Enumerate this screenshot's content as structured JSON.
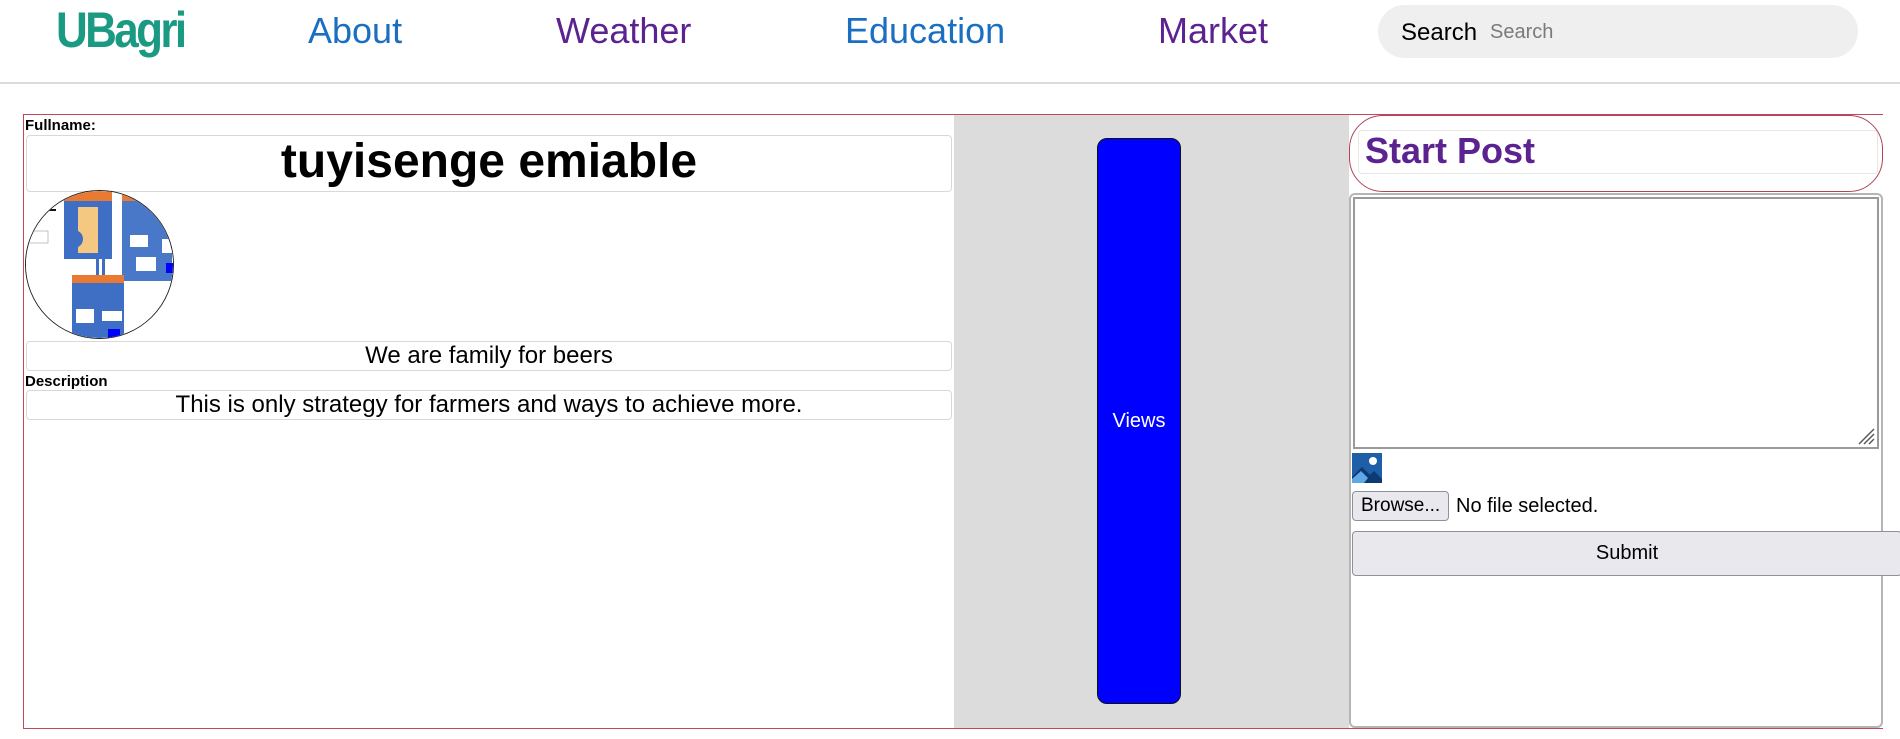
{
  "header": {
    "logo_text": "UBagri",
    "nav": [
      {
        "label": "About"
      },
      {
        "label": "Weather"
      },
      {
        "label": "Education"
      },
      {
        "label": "Market"
      }
    ],
    "search": {
      "label": "Search",
      "placeholder": "Search",
      "value": ""
    }
  },
  "profile": {
    "fullname_label": "Fullname:",
    "fullname": "tuyisenge emiable",
    "motto": "We are family for beers",
    "description_label": "Description",
    "description": "This is only strategy for farmers and ways to achieve more."
  },
  "stats": {
    "views_label": "Views"
  },
  "post": {
    "heading": "Start Post",
    "textarea_value": "",
    "browse_label": "Browse...",
    "file_status": "No file selected.",
    "submit_label": "Submit"
  },
  "colors": {
    "logo": "#1a9a83",
    "nav_blue": "#1a6fc2",
    "nav_purple": "#5b2290",
    "views_button": "#0000ff",
    "container_border": "#c0475c",
    "middle_panel": "#dcdcdc"
  }
}
